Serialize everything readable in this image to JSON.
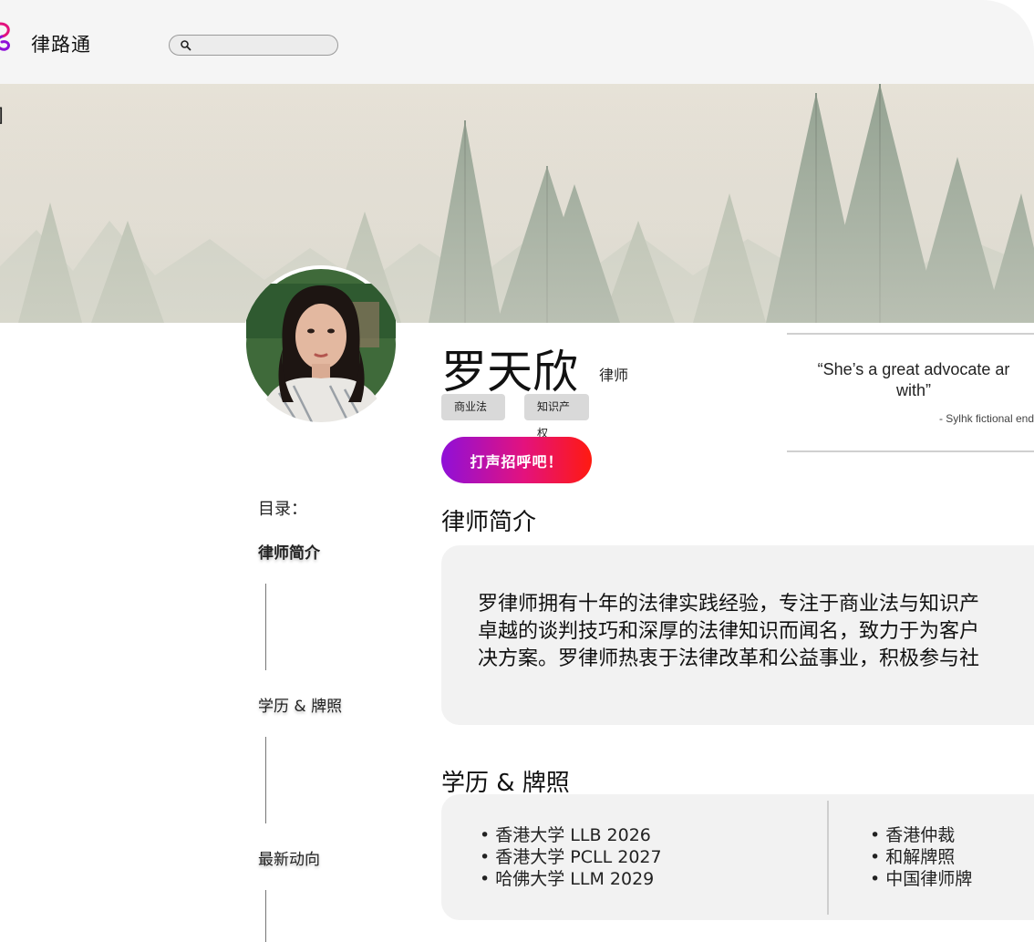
{
  "app": {
    "name": "律路通"
  },
  "search": {
    "placeholder": ""
  },
  "profile": {
    "name": "罗天欣",
    "title": "律师",
    "tags": [
      "商业法",
      "知识产权"
    ],
    "greet_label": "打声招呼吧！"
  },
  "quote": {
    "line1": "“She’s a great advocate ar",
    "line2": "with”",
    "source": "- Sylhk fictional end"
  },
  "toc": {
    "title": "目录：",
    "items": [
      "律师简介",
      "学历 & 牌照",
      "最新动向"
    ]
  },
  "bio": {
    "heading": "律师简介",
    "lines": [
      "罗律师拥有十年的法律实践经验，专注于商业法与知识产",
      "卓越的谈判技巧和深厚的法律知识而闻名，致力于为客户",
      "决方案。罗律师热衷于法律改革和公益事业，积极参与社"
    ]
  },
  "education": {
    "heading": "学历 & 牌照",
    "degrees": [
      "香港大学 LLB 2026",
      "香港大学 PCLL 2027",
      "哈佛大学 LLM 2029"
    ],
    "licenses": [
      "香港仲裁",
      "和解牌照",
      "中国律师牌"
    ]
  },
  "colors": {
    "button_gradient": [
      "#8f10d8",
      "#e3127e",
      "#ff1a10"
    ],
    "panel": "#f2f2f2"
  }
}
